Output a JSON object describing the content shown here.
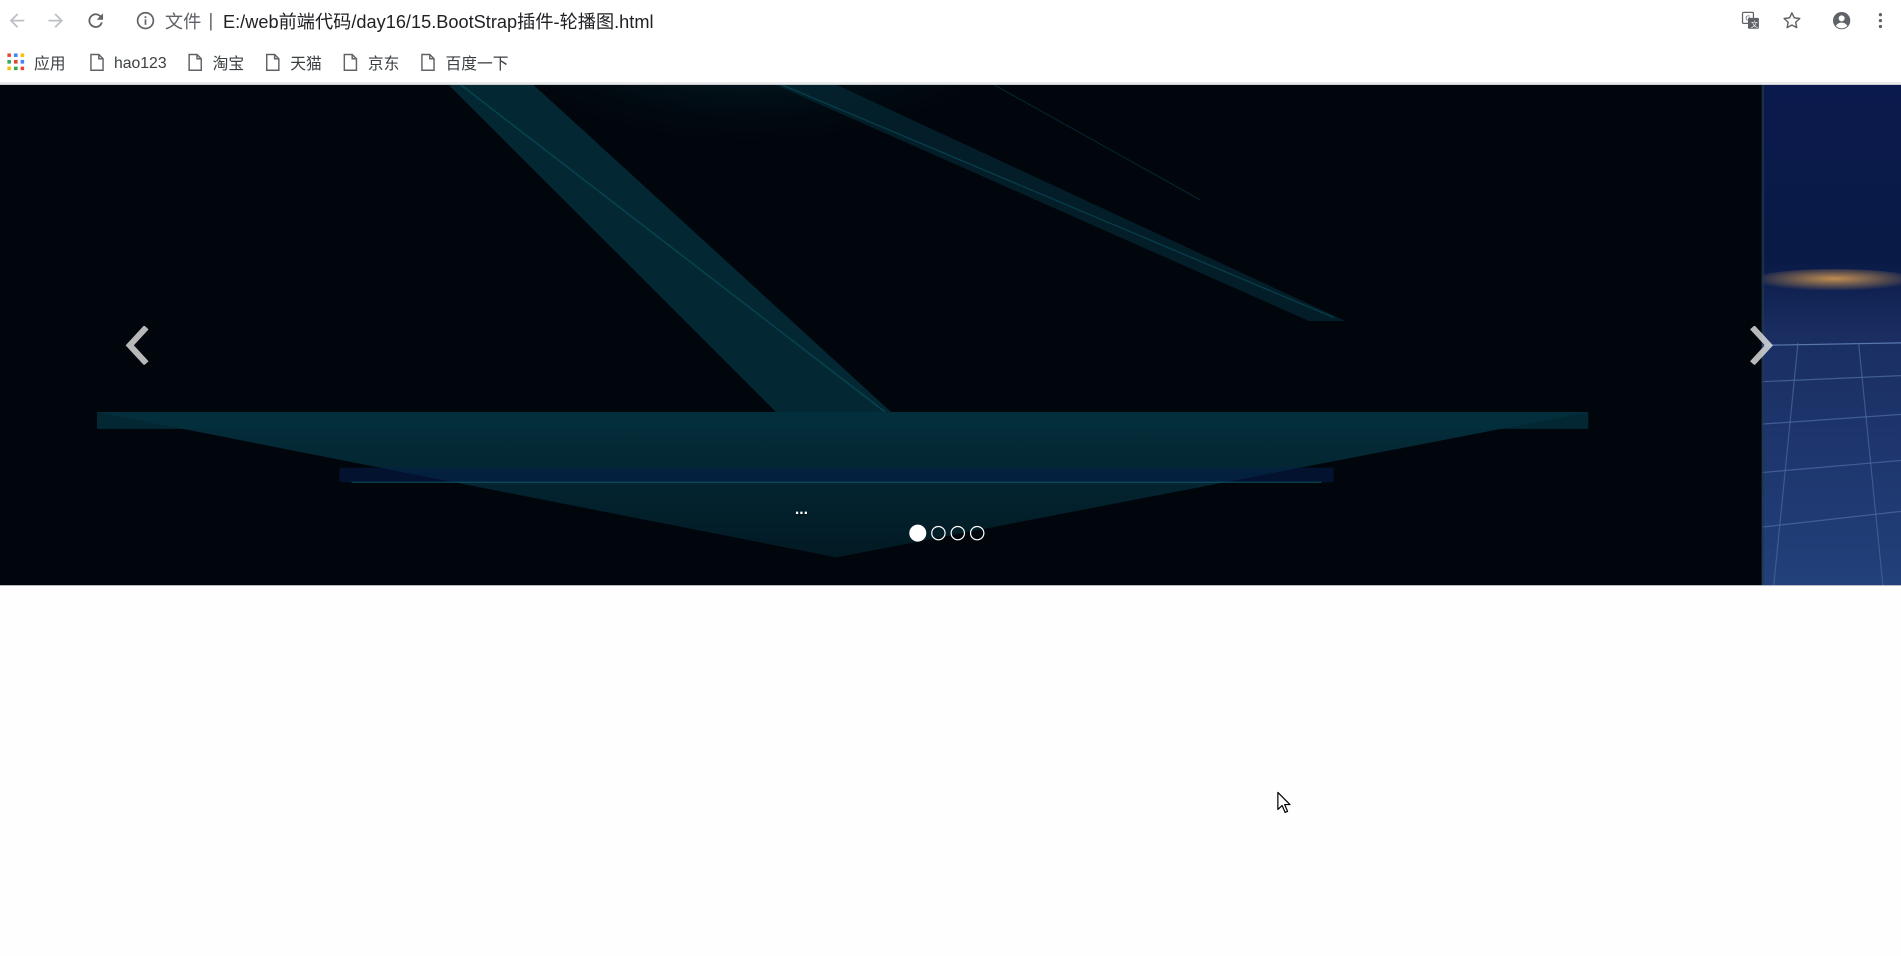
{
  "browser": {
    "nav": {
      "back_icon": "arrow-left-icon",
      "forward_icon": "arrow-right-icon",
      "reload_icon": "reload-icon"
    },
    "omnibox": {
      "security_icon": "info-icon",
      "scheme_label": "文件",
      "separator": "|",
      "url": "E:/web前端代码/day16/15.BootStrap插件-轮播图.html"
    },
    "right_icons": [
      "translate-icon",
      "star-icon",
      "account-icon",
      "menu-icon"
    ],
    "bookmarks": [
      {
        "label": "应用",
        "icon": "apps-grid-icon"
      },
      {
        "label": "hao123",
        "icon": "page-icon"
      },
      {
        "label": "淘宝",
        "icon": "page-icon"
      },
      {
        "label": "天猫",
        "icon": "page-icon"
      },
      {
        "label": "京东",
        "icon": "page-icon"
      },
      {
        "label": "百度一下",
        "icon": "page-icon"
      }
    ]
  },
  "carousel": {
    "caption": "...",
    "prev_icon": "chevron-left-icon",
    "next_icon": "chevron-right-icon",
    "slide_count": 4,
    "active_index": 0
  },
  "colors": {
    "slide_bg": "#01060c",
    "slide_teal": "#033847",
    "peek_blue": "#0d1f5c",
    "indicator": "#ffffff"
  }
}
